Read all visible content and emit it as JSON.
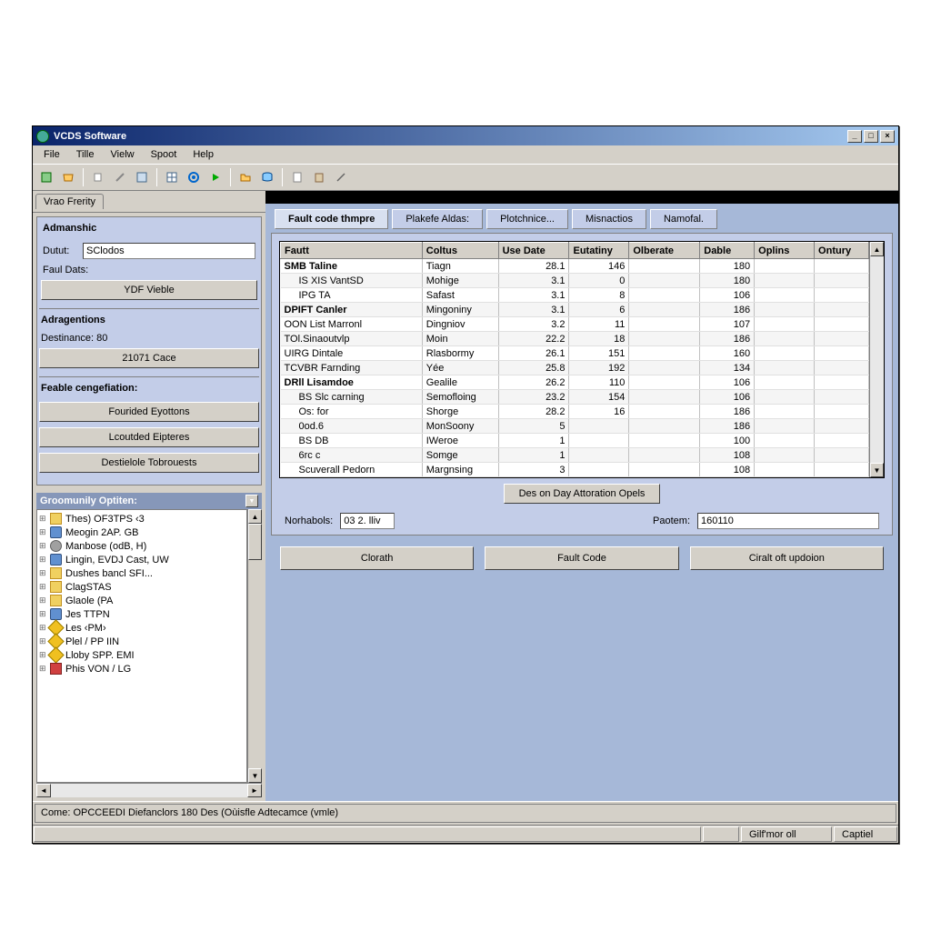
{
  "titlebar": {
    "title": "VCDS Software"
  },
  "menu": {
    "file": "File",
    "title": "Tille",
    "view": "Vielw",
    "sport": "Spoot",
    "help": "Help"
  },
  "left": {
    "tab": "Vrao Frerity",
    "panel1_title": "Admanshic",
    "dutut_label": "Dutut:",
    "dutut_value": "SClodos",
    "faul_dats": "Faul Dats:",
    "ydf_btn": "YDF Vieble",
    "panel2_title": "Adragentions",
    "destinance": "Destinance:  80",
    "cace_btn": "21071 Cace",
    "panel3_title": "Feable cengefiation:",
    "btn1": "Fourided Eyottons",
    "btn2": "Lcoutded Eipteres",
    "btn3": "Destielole Tobrouests",
    "tree_title": "Groomunily Optiten:",
    "tree": [
      "Thes) OF3TPS ‹3",
      "Meogin 2AP. GB",
      "Manbose (odB, H)",
      "Lingin, EVDJ Cast, UW",
      "Dushes bancl  SFI...",
      "ClagSTAS",
      "Glaole  (PA",
      "Jes TTPN",
      "Les ‹PM›",
      "Plel / PP IIN",
      "Lloby SPP. EMI",
      "Phis VON / LG"
    ]
  },
  "main": {
    "tabs": [
      "Fault code thmpre",
      "Plakefe Aldas:",
      "Plotchnice...",
      "Misnactios",
      "Namofal."
    ],
    "headers": [
      "Fautt",
      "Coltus",
      "Use Date",
      "Eutatiny",
      "Olberate",
      "Dable",
      "Oplins",
      "Ontury"
    ],
    "rows": [
      {
        "c": [
          "SMB Taline",
          "Tiagn",
          "28.1",
          "146",
          "",
          "180",
          "",
          ""
        ],
        "b": true
      },
      {
        "c": [
          "IS XIS VantSD",
          "Mohige",
          "3.1",
          "0",
          "",
          "180",
          "",
          ""
        ],
        "i": true
      },
      {
        "c": [
          "IPG TA",
          "Safast",
          "3.1",
          "8",
          "",
          "106",
          "",
          ""
        ],
        "i": true
      },
      {
        "c": [
          "DPIFT Canler",
          "Mingoniny",
          "3.1",
          "6",
          "",
          "186",
          "",
          ""
        ],
        "b": true
      },
      {
        "c": [
          "OON List Marronl",
          "Dingniov",
          "3.2",
          "11",
          "",
          "107",
          "",
          ""
        ]
      },
      {
        "c": [
          "TOl.Sinaoutvlp",
          "Moin",
          "22.2",
          "18",
          "",
          "186",
          "",
          ""
        ]
      },
      {
        "c": [
          "UIRG Dintale",
          "Rlasbormy",
          "26.1",
          "151",
          "",
          "160",
          "",
          ""
        ]
      },
      {
        "c": [
          "TCVBR Farnding",
          "Yée",
          "25.8",
          "192",
          "",
          "134",
          "",
          ""
        ]
      },
      {
        "c": [
          "DRll Lisamdoe",
          "Gealile",
          "26.2",
          "110",
          "",
          "106",
          "",
          ""
        ],
        "b": true
      },
      {
        "c": [
          "BS Slc carning",
          "Semofloing",
          "23.2",
          "154",
          "",
          "106",
          "",
          ""
        ],
        "i": true
      },
      {
        "c": [
          "Os: for",
          "Shorge",
          "28.2",
          "16",
          "",
          "186",
          "",
          ""
        ],
        "i": true
      },
      {
        "c": [
          "0od.6",
          "MonSoony",
          "5",
          "",
          "",
          "186",
          "",
          ""
        ],
        "i": true
      },
      {
        "c": [
          "BS DB",
          "IWeroe",
          "1",
          "",
          "",
          "100",
          "",
          ""
        ],
        "i": true
      },
      {
        "c": [
          "6rc c",
          "Somge",
          "1",
          "",
          "",
          "108",
          "",
          ""
        ],
        "i": true
      },
      {
        "c": [
          "Scuverall Pedorn",
          "Margnsing",
          "3",
          "",
          "",
          "108",
          "",
          ""
        ],
        "i": true
      }
    ],
    "center_btn": "Des on Day Attoration Opels",
    "norhabols_label": "Norhabols:",
    "norhabols_value": "03 2. lliv",
    "paotem_label": "Paotem:",
    "paotem_value": "160110",
    "btn_clorath": "Clorath",
    "btn_fault": "Fault Code",
    "btn_ciralt": "Ciralt oft updoion"
  },
  "status": {
    "line": "Come: OPCCEEDI Diefanclors 180 Des (Oùisfle  Adtecamce (vmle)",
    "cell1": "Gilf'mor oll",
    "cell2": "Captiel"
  }
}
